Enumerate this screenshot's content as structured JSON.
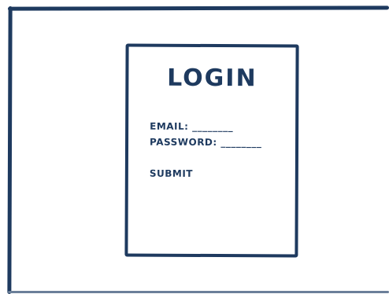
{
  "login": {
    "title": "LOGIN",
    "email_label": "EMAIL:",
    "email_value": "________",
    "password_label": "PASSWORD:",
    "password_value": "________",
    "submit_label": "SUBMIT"
  },
  "colors": {
    "ink": "#1e3a5f",
    "background": "#ffffff"
  }
}
